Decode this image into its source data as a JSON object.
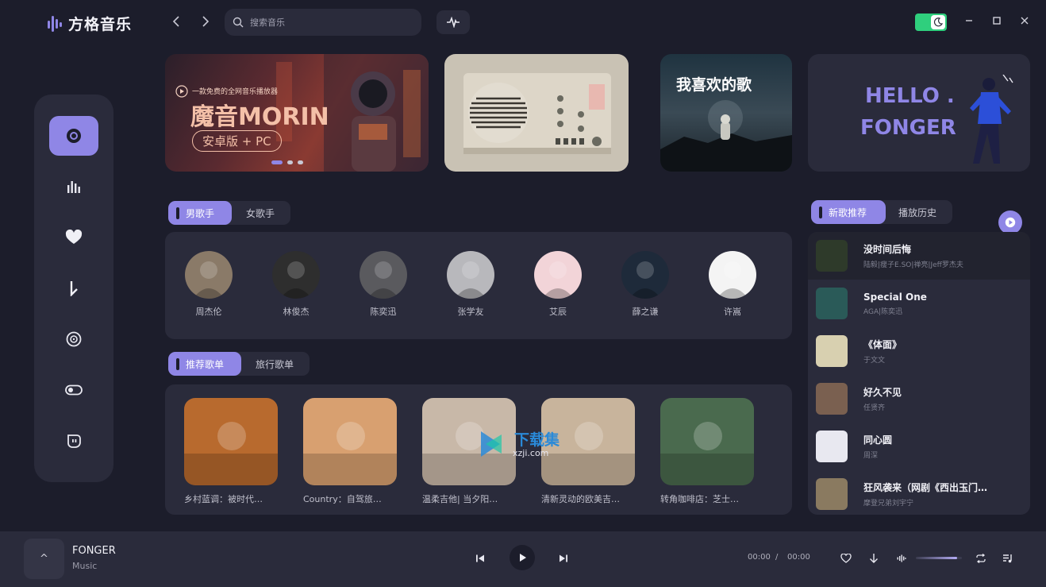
{
  "app": {
    "name": "方格音乐"
  },
  "search": {
    "placeholder": "搜索音乐"
  },
  "window": {
    "accent": "#8f86e6",
    "toggle_color": "#2fcf7d"
  },
  "sidebar": {
    "items": [
      {
        "icon": "disc-icon",
        "active": true
      },
      {
        "icon": "chart-bars-icon",
        "active": false
      },
      {
        "icon": "heart-icon",
        "active": false
      },
      {
        "icon": "download-icon",
        "active": false
      },
      {
        "icon": "vinyl-icon",
        "active": false
      },
      {
        "icon": "toggle-icon",
        "active": false
      },
      {
        "icon": "bot-icon",
        "active": false
      }
    ]
  },
  "banners": {
    "b1": {
      "tagline": "一款免费的全网音乐播放器",
      "title": "魔音MORIN",
      "subtitle": "安卓版 + PC"
    },
    "b3": {
      "title": "我喜欢的歌"
    },
    "b4": {
      "line1": "HELLO .",
      "line2": "FONGER"
    }
  },
  "singer_tabs": [
    "男歌手",
    "女歌手"
  ],
  "singers": [
    {
      "name": "周杰伦",
      "color": "#8a7a68"
    },
    {
      "name": "林俊杰",
      "color": "#2e2e2e"
    },
    {
      "name": "陈奕迅",
      "color": "#5a5a5e"
    },
    {
      "name": "张学友",
      "color": "#b8b8bc"
    },
    {
      "name": "艾辰",
      "color": "#f2d4d8"
    },
    {
      "name": "薛之谦",
      "color": "#1e2a3a"
    },
    {
      "name": "许嵩",
      "color": "#f4f4f4"
    }
  ],
  "playlist_tabs": [
    "推荐歌单",
    "旅行歌单"
  ],
  "playlists": [
    {
      "title": "乡村蓝调：被时代…",
      "color": "#b86a2e"
    },
    {
      "title": "Country：自驾旅…",
      "color": "#d8a070"
    },
    {
      "title": "温柔吉他| 当夕阳…",
      "color": "#c8b8a8"
    },
    {
      "title": "清新灵动的欧美吉…",
      "color": "#c8b49c"
    },
    {
      "title": "转角咖啡店：芝士…",
      "color": "#4a6a4e"
    }
  ],
  "watermark": {
    "text": "下载集",
    "sub": "xzji.com"
  },
  "song_tabs": [
    "新歌推荐",
    "播放历史"
  ],
  "songs": [
    {
      "title": "没时间后悔",
      "artist": "陆毅|瘦子E.SO|禅亮|Jeff罗杰夫",
      "color": "#2e3a2a"
    },
    {
      "title": "Special One",
      "artist": "AGA|陈奕迅",
      "color": "#2a5a58"
    },
    {
      "title": "《体面》",
      "artist": "于文文",
      "color": "#d8d0b0"
    },
    {
      "title": "好久不见",
      "artist": "任贤齐",
      "color": "#7a6050"
    },
    {
      "title": "同心圆",
      "artist": "周深",
      "color": "#e8e8f0"
    },
    {
      "title": "狂风袭来（网剧《西出玉门…",
      "artist": "摩登兄弟刘宇宁",
      "color": "#8a7a60"
    }
  ],
  "player": {
    "title": "FONGER",
    "subtitle": "Music",
    "cover_glyph": "^",
    "time_current": "00:00",
    "time_sep": "/",
    "time_total": "00:00",
    "volume_fraction": 0.9
  }
}
